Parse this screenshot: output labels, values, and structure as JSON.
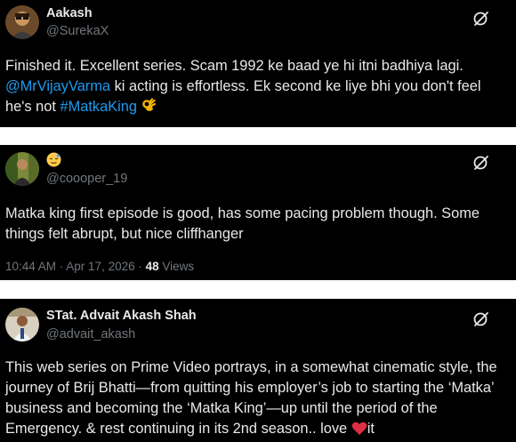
{
  "tweets": [
    {
      "name": "Aakash",
      "handle": "@SurekaX",
      "text_part1": "Finished it. Excellent series. Scam 1992 ke baad ye hi itni badhiya lagi. ",
      "mention": "@MrVijayVarma",
      "text_part2": " ki acting is effortless. Ek second ke liye bhi you don't feel he's not ",
      "hashtag": "#MatkaKing",
      "end_emoji": "ok-hand-emoji"
    },
    {
      "name_emoji": "relieved-face-emoji",
      "handle": "@coooper_19",
      "text": "Matka king first episode is good, has some pacing problem though. Some things felt abrupt, but nice cliffhanger",
      "timestamp": "10:44 AM · Apr 17, 2026 · ",
      "views_count": "48",
      "views_label": " Views"
    },
    {
      "name": "STat. Advait Akash Shah",
      "handle": "@advait_akash",
      "text_part1": "This web series on Prime Video portrays, in a somewhat cinematic style, the journey of Brij Bhatti—from quitting his employer’s job to starting the ‘Matka’ business and becoming the ‘Matka King’—up until the period of the Emergency. & rest continuing in its 2nd season.. love ",
      "heart_emoji": "red-heart-emoji",
      "text_part2": "it"
    }
  ],
  "icons": {
    "grok": "grok-icon"
  },
  "colors": {
    "background": "#000000",
    "text": "#e7e9ea",
    "secondary": "#71767b",
    "link": "#1d9bf0",
    "separator": "#ffffff"
  }
}
